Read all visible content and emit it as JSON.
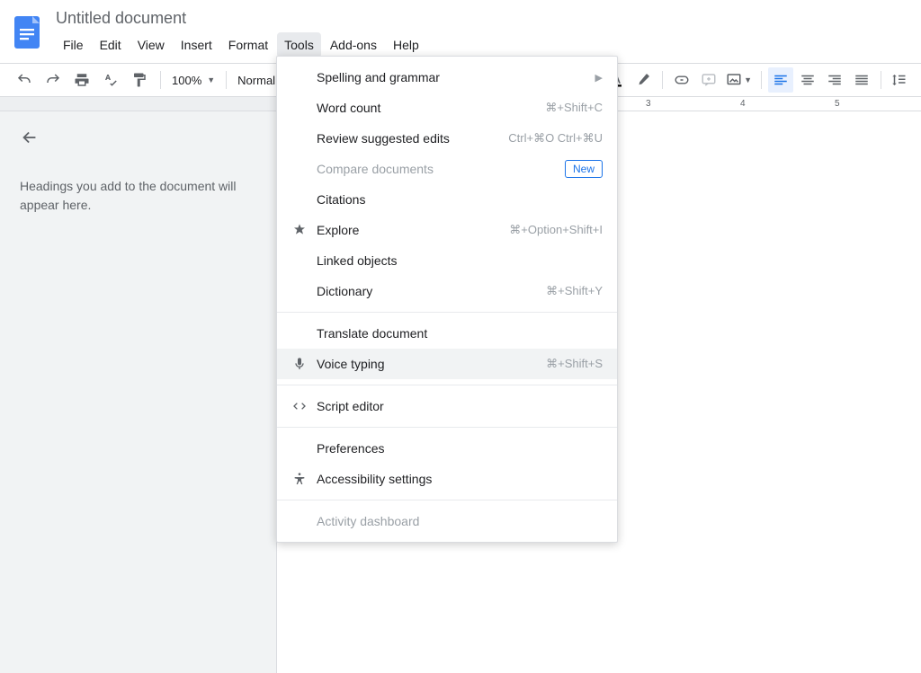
{
  "doc": {
    "title": "Untitled document"
  },
  "menubar": [
    {
      "label": "File"
    },
    {
      "label": "Edit"
    },
    {
      "label": "View"
    },
    {
      "label": "Insert"
    },
    {
      "label": "Format"
    },
    {
      "label": "Tools",
      "active": true
    },
    {
      "label": "Add-ons"
    },
    {
      "label": "Help"
    }
  ],
  "toolbar": {
    "zoom": "100%",
    "style": "Normal"
  },
  "ruler": {
    "marks": [
      "3",
      "4",
      "5"
    ]
  },
  "outline": {
    "placeholder": "Headings you add to the document will appear here."
  },
  "tools_menu": [
    {
      "label": "Spelling and grammar",
      "submenu": true
    },
    {
      "label": "Word count",
      "shortcut": "⌘+Shift+C"
    },
    {
      "label": "Review suggested edits",
      "shortcut": "Ctrl+⌘O Ctrl+⌘U"
    },
    {
      "label": "Compare documents",
      "disabled": true,
      "badge": "New"
    },
    {
      "label": "Citations"
    },
    {
      "label": "Explore",
      "shortcut": "⌘+Option+Shift+I",
      "icon": "explore"
    },
    {
      "label": "Linked objects"
    },
    {
      "label": "Dictionary",
      "shortcut": "⌘+Shift+Y"
    },
    {
      "sep": true
    },
    {
      "label": "Translate document"
    },
    {
      "label": "Voice typing",
      "shortcut": "⌘+Shift+S",
      "icon": "mic",
      "hover": true
    },
    {
      "sep": true
    },
    {
      "label": "Script editor",
      "icon": "script"
    },
    {
      "sep": true
    },
    {
      "label": "Preferences"
    },
    {
      "label": "Accessibility settings",
      "icon": "accessibility"
    },
    {
      "sep": true
    },
    {
      "label": "Activity dashboard",
      "disabled": true
    }
  ]
}
